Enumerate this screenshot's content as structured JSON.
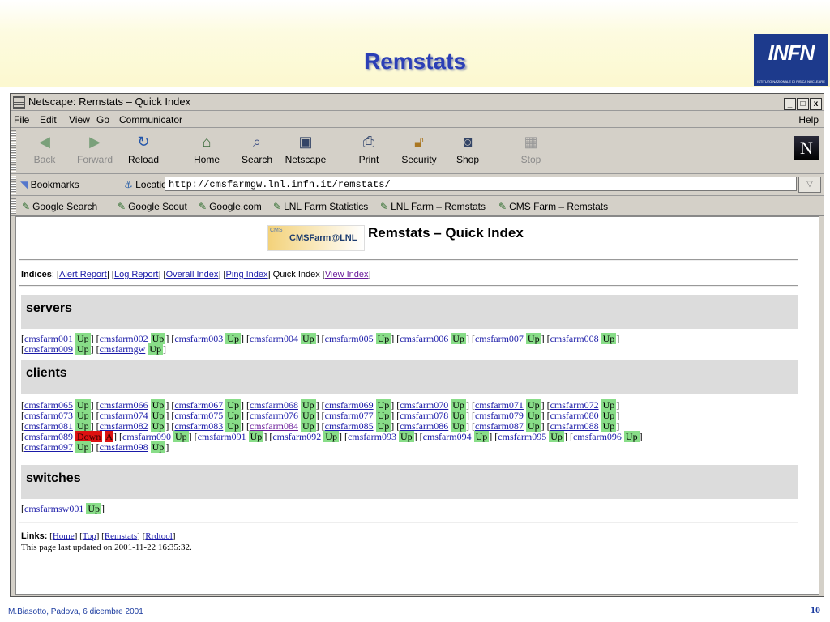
{
  "slide": {
    "title": "Remstats",
    "logo_text": "INFN",
    "logo_subtext": "ISTITUTO NAZIONALE DI FISICA NUCLEARE",
    "footer_left": "M.Biasotto, Padova, 6 dicembre 2001",
    "page_number": "10"
  },
  "window": {
    "title": "Netscape: Remstats – Quick Index",
    "buttons": [
      "_",
      "□",
      "x"
    ]
  },
  "menu": {
    "items": [
      "File",
      "Edit",
      "View",
      "Go",
      "Communicator"
    ],
    "help": "Help"
  },
  "toolbar": {
    "buttons": [
      {
        "label": "Back",
        "icon": "back-arrow-icon",
        "disabled": true
      },
      {
        "label": "Forward",
        "icon": "forward-arrow-icon",
        "disabled": true
      },
      {
        "label": "Reload",
        "icon": "reload-icon",
        "disabled": false
      },
      {
        "label": "Home",
        "icon": "home-icon",
        "disabled": false
      },
      {
        "label": "Search",
        "icon": "search-icon",
        "disabled": false
      },
      {
        "label": "Netscape",
        "icon": "netscape-icon",
        "disabled": false
      },
      {
        "label": "Print",
        "icon": "print-icon",
        "disabled": false
      },
      {
        "label": "Security",
        "icon": "lock-icon",
        "disabled": false
      },
      {
        "label": "Shop",
        "icon": "shop-icon",
        "disabled": false
      },
      {
        "label": "Stop",
        "icon": "stop-icon",
        "disabled": true
      }
    ],
    "brand_letter": "N"
  },
  "location": {
    "bookmarks_label": "Bookmarks",
    "location_label": "Location:",
    "url": "http://cmsfarmgw.lnl.infn.it/remstats/"
  },
  "personal_toolbar": {
    "items": [
      "Google Search",
      "Google Scout",
      "Google.com",
      "LNL Farm Statistics",
      "LNL Farm – Remstats",
      "CMS Farm – Remstats"
    ]
  },
  "page": {
    "logo_small": "CMS",
    "logo_text": "CMSFarm@LNL",
    "title": "Remstats – Quick Index",
    "indices_label": "Indices",
    "indices": {
      "alert": "Alert Report",
      "log": "Log Report",
      "overall": "Overall Index",
      "ping": "Ping Index",
      "quick": "Quick Index",
      "view": "View Index"
    },
    "status_up": "Up",
    "status_down": "Down",
    "status_a": "A",
    "sections": {
      "servers": "servers",
      "clients": "clients",
      "switches": "switches"
    },
    "servers": [
      "cmsfarm001",
      "cmsfarm002",
      "cmsfarm003",
      "cmsfarm004",
      "cmsfarm005",
      "cmsfarm006",
      "cmsfarm007",
      "cmsfarm008",
      "cmsfarm009",
      "cmsfarmgw"
    ],
    "clients_row1": [
      "cmsfarm065",
      "cmsfarm066",
      "cmsfarm067",
      "cmsfarm068",
      "cmsfarm069",
      "cmsfarm070",
      "cmsfarm071",
      "cmsfarm072"
    ],
    "clients_row2": [
      "cmsfarm073",
      "cmsfarm074",
      "cmsfarm075",
      "cmsfarm076",
      "cmsfarm077",
      "cmsfarm078",
      "cmsfarm079",
      "cmsfarm080"
    ],
    "clients_row3": [
      "cmsfarm081",
      "cmsfarm082",
      "cmsfarm083",
      "cmsfarm084",
      "cmsfarm085",
      "cmsfarm086",
      "cmsfarm087",
      "cmsfarm088"
    ],
    "clients_row4_down": "cmsfarm089",
    "clients_row4": [
      "cmsfarm090",
      "cmsfarm091",
      "cmsfarm092",
      "cmsfarm093",
      "cmsfarm094",
      "cmsfarm095",
      "cmsfarm096"
    ],
    "clients_row5": [
      "cmsfarm097",
      "cmsfarm098"
    ],
    "switches": [
      "cmsfarmsw001"
    ],
    "links_label": "Links:",
    "links": {
      "home": "Home",
      "top": "Top",
      "remstats": "Remstats",
      "rrdtool": "Rrdtool"
    },
    "updated": "This page last updated on 2001-11-22 16:35:32."
  }
}
